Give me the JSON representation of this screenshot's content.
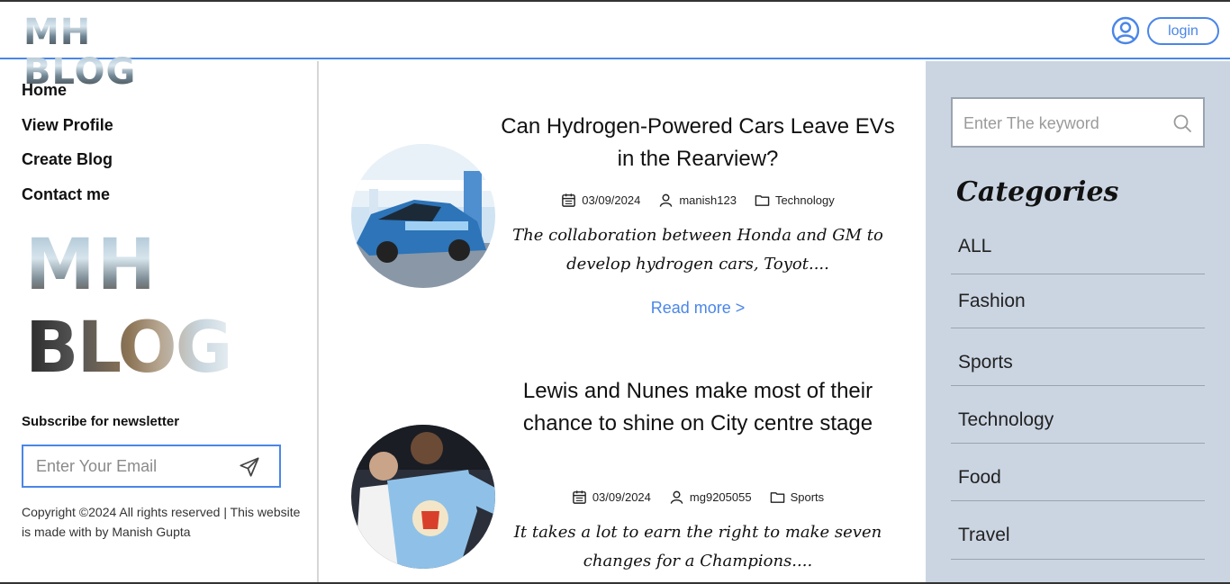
{
  "header": {
    "logo_text": "MH BLOG",
    "login_label": "login"
  },
  "sidebar": {
    "nav": [
      {
        "label": "Home"
      },
      {
        "label": "View Profile"
      },
      {
        "label": "Create Blog"
      },
      {
        "label": "Contact me"
      }
    ],
    "logo_line1": "MH",
    "logo_line2": "BLOG",
    "newsletter_title": "Subscribe for newsletter",
    "email_placeholder": "Enter Your Email",
    "copyright": "Copyright ©2024 All rights reserved | This website is made with by Manish Gupta"
  },
  "posts": [
    {
      "title": "Can Hydrogen-Powered Cars Leave EVs in the Rearview?",
      "date": "03/09/2024",
      "author": "manish123",
      "category": "Technology",
      "excerpt": "The collaboration between Honda and GM to develop hydrogen cars, Toyot....",
      "read_more": "Read more >"
    },
    {
      "title": "Lewis and Nunes make most of their chance to shine on City centre stage",
      "date": "03/09/2024",
      "author": "mg9205055",
      "category": "Sports",
      "excerpt": "It takes a lot to earn the right to make seven changes for a Champions...."
    }
  ],
  "right": {
    "search_placeholder": "Enter The keyword",
    "categories_title": "Categories",
    "categories": [
      "ALL",
      "Fashion",
      "Sports",
      "Technology",
      "Food",
      "Travel"
    ]
  },
  "colors": {
    "accent": "#4a86e8",
    "right_panel_bg": "#cbd5e2",
    "divider": "#9aa4b0"
  }
}
